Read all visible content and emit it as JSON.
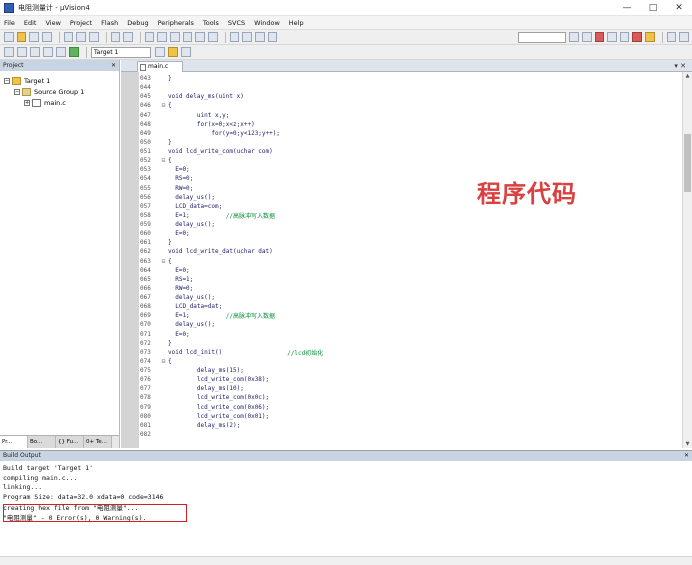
{
  "window": {
    "title": "电阻测量计 - µVision4",
    "controls": [
      "—",
      "□",
      "✕"
    ]
  },
  "menu": [
    "File",
    "Edit",
    "View",
    "Project",
    "Flash",
    "Debug",
    "Peripherals",
    "Tools",
    "SVCS",
    "Window",
    "Help"
  ],
  "toolbar": {
    "target": "Target 1"
  },
  "project_panel": {
    "title": "Project",
    "tree": [
      {
        "label": "Target 1",
        "level": 0
      },
      {
        "label": "Source Group 1",
        "level": 1
      },
      {
        "label": "main.c",
        "level": 2
      }
    ],
    "tabs": [
      "Pr...",
      "Bo...",
      "{} Fu...",
      "0+ Te..."
    ]
  },
  "editor": {
    "tab": "main.c",
    "overlay_text": "程序代码",
    "lines": [
      {
        "n": "043",
        "fold": "",
        "code": "}"
      },
      {
        "n": "044",
        "fold": "",
        "code": ""
      },
      {
        "n": "045",
        "fold": "",
        "code": "void delay_ms(uint x)"
      },
      {
        "n": "046",
        "fold": "⊟",
        "code": "{"
      },
      {
        "n": "047",
        "fold": "",
        "code": "        uint x,y;"
      },
      {
        "n": "048",
        "fold": "",
        "code": "        for(x=0;x<z;x++)"
      },
      {
        "n": "049",
        "fold": "",
        "code": "            for(y=0;y<123;y++);"
      },
      {
        "n": "050",
        "fold": "",
        "code": "}"
      },
      {
        "n": "051",
        "fold": "",
        "code": "void lcd_write_com(uchar com)"
      },
      {
        "n": "052",
        "fold": "⊟",
        "code": "{"
      },
      {
        "n": "053",
        "fold": "",
        "code": "  E=0;"
      },
      {
        "n": "054",
        "fold": "",
        "code": "  RS=0;"
      },
      {
        "n": "055",
        "fold": "",
        "code": "  RW=0;"
      },
      {
        "n": "056",
        "fold": "",
        "code": "  delay_us();"
      },
      {
        "n": "057",
        "fold": "",
        "code": "  LCD_data=com;"
      },
      {
        "n": "058",
        "fold": "",
        "code": "  E=1;",
        "comment": "          //高脉冲写入数据"
      },
      {
        "n": "059",
        "fold": "",
        "code": "  delay_us();"
      },
      {
        "n": "060",
        "fold": "",
        "code": "  E=0;"
      },
      {
        "n": "061",
        "fold": "",
        "code": "}"
      },
      {
        "n": "062",
        "fold": "",
        "code": "void lcd_write_dat(uchar dat)"
      },
      {
        "n": "063",
        "fold": "⊟",
        "code": "{"
      },
      {
        "n": "064",
        "fold": "",
        "code": "  E=0;"
      },
      {
        "n": "065",
        "fold": "",
        "code": "  RS=1;"
      },
      {
        "n": "066",
        "fold": "",
        "code": "  RW=0;"
      },
      {
        "n": "067",
        "fold": "",
        "code": "  delay_us();"
      },
      {
        "n": "068",
        "fold": "",
        "code": "  LCD_data=dat;"
      },
      {
        "n": "069",
        "fold": "",
        "code": "  E=1;",
        "comment": "          //高脉冲写入数据"
      },
      {
        "n": "070",
        "fold": "",
        "code": "  delay_us();"
      },
      {
        "n": "071",
        "fold": "",
        "code": "  E=0;"
      },
      {
        "n": "072",
        "fold": "",
        "code": "}"
      },
      {
        "n": "073",
        "fold": "",
        "code": "void lcd_init()",
        "comment": "                  //lcd初始化"
      },
      {
        "n": "074",
        "fold": "⊟",
        "code": "{"
      },
      {
        "n": "075",
        "fold": "",
        "code": "        delay_ms(15);"
      },
      {
        "n": "076",
        "fold": "",
        "code": "        lcd_write_com(0x38);"
      },
      {
        "n": "077",
        "fold": "",
        "code": "        delay_ms(10);"
      },
      {
        "n": "078",
        "fold": "",
        "code": "        lcd_write_com(0x0c);"
      },
      {
        "n": "079",
        "fold": "",
        "code": "        lcd_write_com(0x06);"
      },
      {
        "n": "080",
        "fold": "",
        "code": "        lcd_write_com(0x01);"
      },
      {
        "n": "081",
        "fold": "",
        "code": "        delay_ms(2);"
      },
      {
        "n": "082",
        "fold": "",
        "code": ""
      }
    ]
  },
  "build_output": {
    "title": "Build Output",
    "lines": [
      "Build target 'Target 1'",
      "compiling main.c...",
      "linking...",
      "Program Size: data=32.0 xdata=0 code=3146",
      "creating hex file from \"电阻测量\"...",
      "\"电阻测量\" - 0 Error(s), 0 Warning(s)."
    ]
  }
}
